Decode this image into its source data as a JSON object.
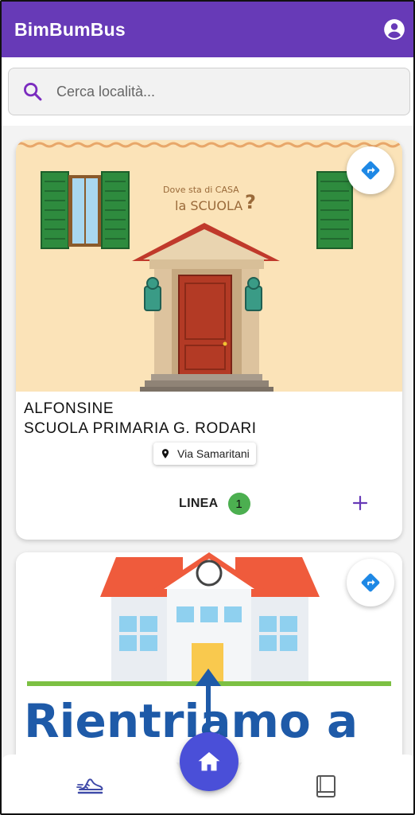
{
  "appbar": {
    "title": "BimBumBus",
    "account_icon": "account-circle-icon"
  },
  "search": {
    "placeholder": "Cerca località...",
    "value": "",
    "icon": "search-icon"
  },
  "cards": [
    {
      "image_text_line1": "Dove sta di CASA",
      "image_text_line2": "la SCUOLA",
      "city": "ALFONSINE",
      "school": "SCUOLA PRIMARIA G. RODARI",
      "address": "Via Samaritani",
      "linea_label": "LINEA",
      "linea_number": "1",
      "directions_icon": "directions-icon",
      "add_icon": "plus-icon"
    },
    {
      "image_text": "Rientriamo a",
      "directions_icon": "directions-icon"
    }
  ],
  "bottom_nav": {
    "left_icon": "shoe-icon",
    "center_icon": "home-icon",
    "right_icon": "book-icon"
  },
  "colors": {
    "primary": "#673ab7",
    "fab": "#4a4fd8",
    "badge": "#4caf50",
    "directions": "#1e88e5"
  }
}
